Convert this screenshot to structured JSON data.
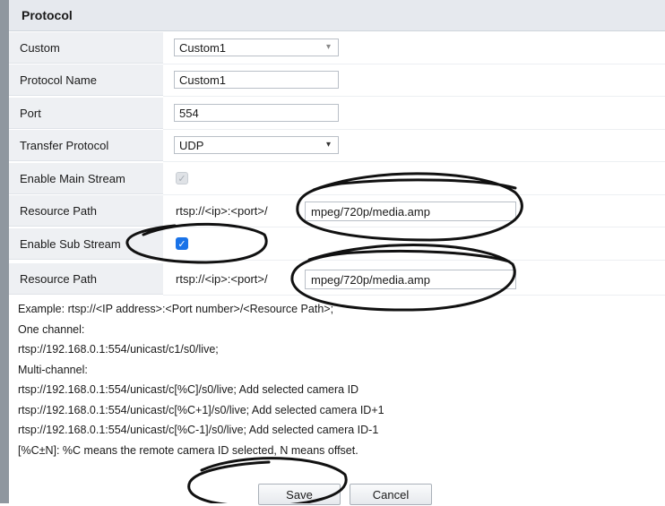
{
  "panel": {
    "title": "Protocol"
  },
  "fields": {
    "custom": {
      "label": "Custom",
      "value": "Custom1"
    },
    "protocol_name": {
      "label": "Protocol Name",
      "value": "Custom1"
    },
    "port": {
      "label": "Port",
      "value": "554"
    },
    "transfer_protocol": {
      "label": "Transfer Protocol",
      "value": "UDP"
    },
    "enable_main_stream": {
      "label": "Enable Main Stream",
      "checked": true,
      "disabled": true
    },
    "main_resource_path": {
      "label": "Resource Path",
      "prefix": "rtsp://<ip>:<port>/",
      "value": "mpeg/720p/media.amp"
    },
    "enable_sub_stream": {
      "label": "Enable Sub Stream",
      "checked": true
    },
    "sub_resource_path": {
      "label": "Resource Path",
      "prefix": "rtsp://<ip>:<port>/",
      "value": "mpeg/720p/media.amp"
    }
  },
  "help_lines": [
    "Example:  rtsp://<IP address>:<Port number>/<Resource Path>;",
    "One channel:",
    "rtsp://192.168.0.1:554/unicast/c1/s0/live;",
    "Multi-channel:",
    "rtsp://192.168.0.1:554/unicast/c[%C]/s0/live;  Add selected camera ID",
    "rtsp://192.168.0.1:554/unicast/c[%C+1]/s0/live;  Add selected camera ID+1",
    "rtsp://192.168.0.1:554/unicast/c[%C-1]/s0/live;  Add selected camera ID-1",
    "[%C±N]:  %C means the remote camera ID selected, N means offset."
  ],
  "buttons": {
    "save": "Save",
    "cancel": "Cancel"
  },
  "icons": {
    "checkmark": "✓",
    "dropdown_arrow": "▾"
  },
  "colors": {
    "checkbox_blue": "#1a73e8",
    "annotation_ink": "#111111"
  }
}
